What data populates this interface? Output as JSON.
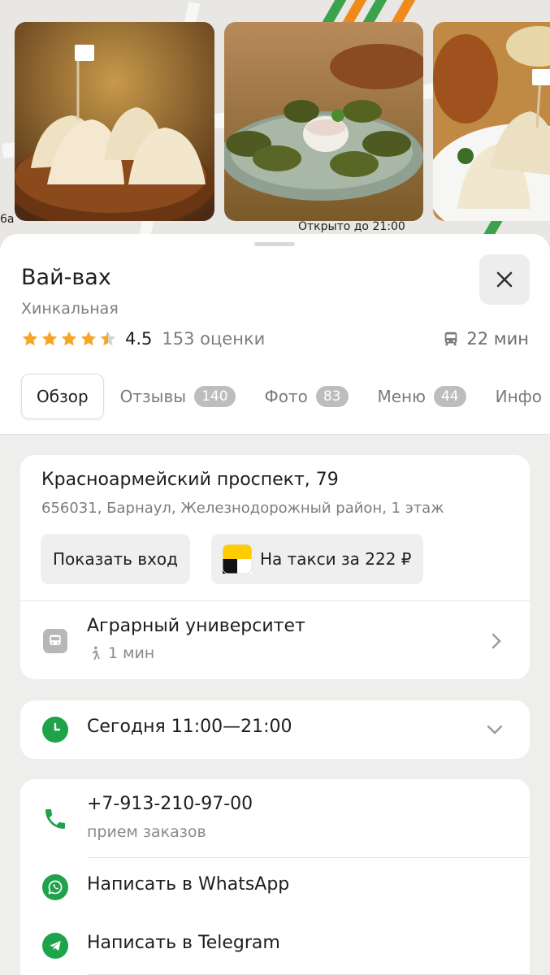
{
  "map": {
    "label_open_until": "Открыто до 21:00",
    "label_6a": "6а"
  },
  "place": {
    "name": "Вай-вах",
    "category": "Хинкальная",
    "rating_value": 4.5,
    "rating_text": "4.5",
    "rating_count": "153 оценки",
    "travel_time": "22 мин",
    "star_color": "#f5a623"
  },
  "tabs": [
    {
      "label": "Обзор",
      "badge": ""
    },
    {
      "label": "Отзывы",
      "badge": "140"
    },
    {
      "label": "Фото",
      "badge": "83"
    },
    {
      "label": "Меню",
      "badge": "44"
    },
    {
      "label": "Инфо",
      "badge": ""
    }
  ],
  "address": {
    "line1": "Красноармейский проспект, 79",
    "line2": "656031, Барнаул, Железнодорожный район, 1 этаж",
    "show_entrance": "Показать вход",
    "taxi": "На такси за 222 ₽"
  },
  "transit": {
    "stop": "Аграрный университет",
    "walk": "1 мин"
  },
  "hours": {
    "today": "Сегодня 11:00—21:00"
  },
  "contacts": {
    "phone": "+7-913-210-97-00",
    "phone_note": "прием заказов",
    "whatsapp": "Написать в WhatsApp",
    "telegram": "Написать в Telegram"
  },
  "colors": {
    "accent_green": "#1ea34a",
    "badge_gray": "#bdbdbd"
  }
}
